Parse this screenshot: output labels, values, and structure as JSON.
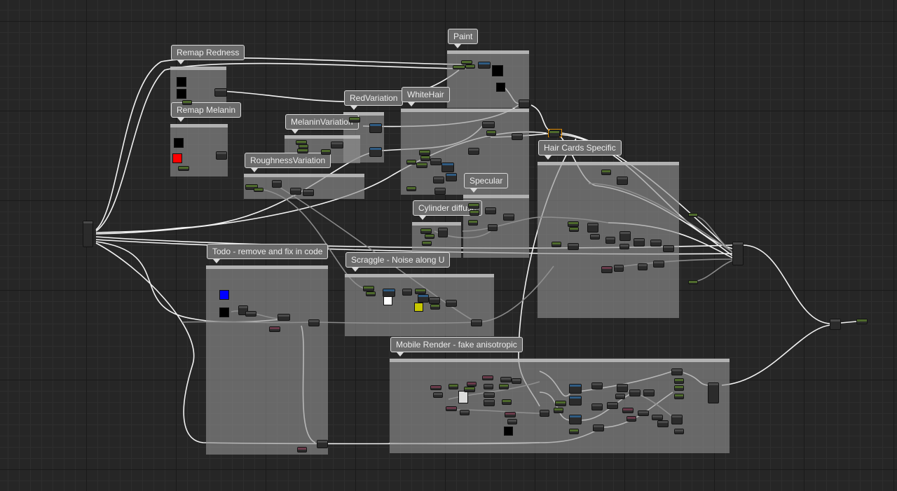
{
  "editor": {
    "view": "Material Graph",
    "comments": [
      {
        "id": "remap-redness",
        "label": "Remap Redness"
      },
      {
        "id": "remap-melanin",
        "label": "Remap Melanin"
      },
      {
        "id": "paint",
        "label": "Paint"
      },
      {
        "id": "red-variation",
        "label": "RedVariation"
      },
      {
        "id": "white-hair",
        "label": "WhiteHair"
      },
      {
        "id": "melanin-variation",
        "label": "MelaninVariation"
      },
      {
        "id": "roughness-variation",
        "label": "RoughnessVariation"
      },
      {
        "id": "hair-cards-specific",
        "label": "Hair Cards Specific"
      },
      {
        "id": "specular",
        "label": "Specular"
      },
      {
        "id": "cylinder-diffuse",
        "label": "Cylinder diffuse"
      },
      {
        "id": "todo",
        "label": "Todo - remove and fix in code"
      },
      {
        "id": "scraggle",
        "label": "Scraggle - Noise along U"
      },
      {
        "id": "mobile-render",
        "label": "Mobile Render - fake anisotropic"
      }
    ],
    "swatch_colors": {
      "black": "#000000",
      "red": "#ff0000",
      "blue": "#0000ff",
      "white": "#ffffff",
      "yellow": "#c8c800",
      "selection": "#e08a00",
      "wire": "#f0f0f0"
    },
    "node_header_colors": {
      "param": "#4e6a2c",
      "texture": "#2f5b82",
      "math": "#4a4a4a",
      "vector": "#6a3a4a",
      "constant": "#54623e"
    }
  }
}
